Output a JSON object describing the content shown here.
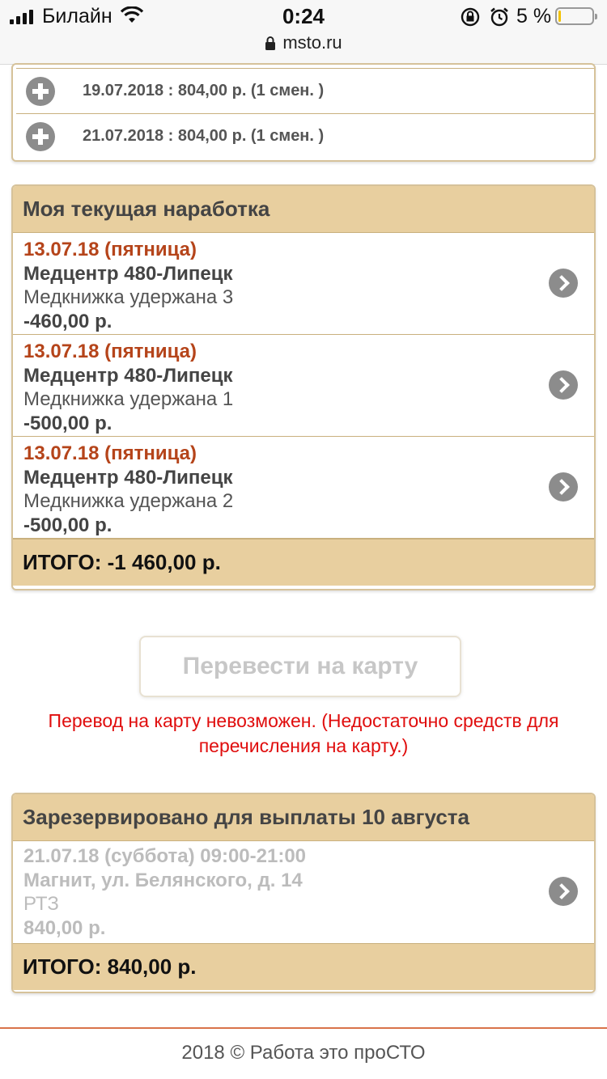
{
  "status_bar": {
    "carrier": "Билайн",
    "time": "0:24",
    "battery_percent": "5 %",
    "battery_level": 0.05
  },
  "browser": {
    "url": "msto.ru"
  },
  "shifts": [
    {
      "text": "19.07.2018 : 804,00 р. (1 смен. )"
    },
    {
      "text": "21.07.2018 : 804,00 р. (1 смен. )"
    }
  ],
  "earnings": {
    "title": "Моя текущая наработка",
    "items": [
      {
        "date": "13.07.18 (пятница)",
        "place": "Медцентр 480-Липецк",
        "desc": "Медкнижка удержана 3",
        "amount": "-460,00 р."
      },
      {
        "date": "13.07.18 (пятница)",
        "place": "Медцентр 480-Липецк",
        "desc": "Медкнижка удержана 1",
        "amount": "-500,00 р."
      },
      {
        "date": "13.07.18 (пятница)",
        "place": "Медцентр 480-Липецк",
        "desc": "Медкнижка удержана 2",
        "amount": "-500,00 р."
      }
    ],
    "total": "ИТОГО: -1 460,00 р."
  },
  "transfer": {
    "button_label": "Перевести на карту",
    "error_line1": "Перевод на карту невозможен. (Недостаточно средств для",
    "error_line2": "перечисления на карту.)"
  },
  "reserved": {
    "title": "Зарезервировано для выплаты 10 августа",
    "item": {
      "date": "21.07.18 (суббота) 09:00-21:00",
      "place": "Магнит, ул. Белянского, д. 14",
      "desc": "РТЗ",
      "amount": "840,00 р."
    },
    "total": "ИТОГО: 840,00 р."
  },
  "footer": {
    "text": "2018 © Работа это проСТО"
  },
  "colors": {
    "accent_tan": "#e8cf9f",
    "date_red": "#b5441a",
    "error_red": "#e00d0d",
    "footer_line": "#d9734a"
  }
}
